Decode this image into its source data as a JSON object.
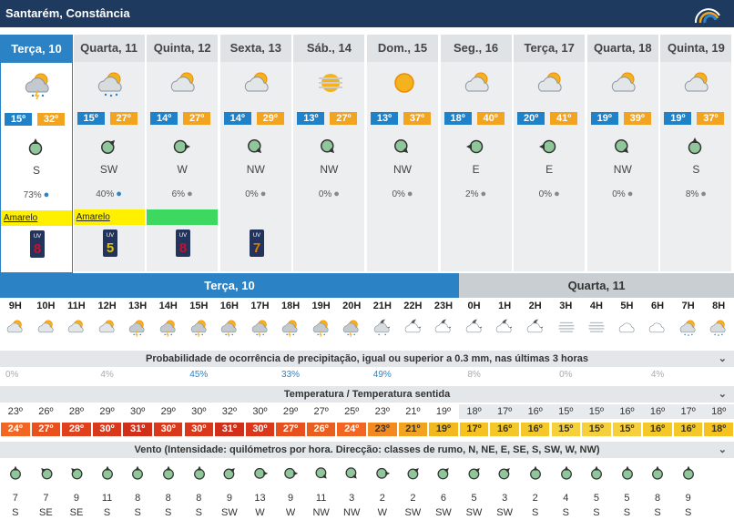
{
  "header": {
    "title": "Santarém, Constância",
    "logo": "ipma-logo-icon"
  },
  "days": [
    {
      "name": "Terça, 10",
      "icon": "storm-cloud-icon",
      "tmin": "15º",
      "tmax": "32º",
      "wind_dir": "S",
      "precip": "73%",
      "warning": "Amarelo",
      "warn_color": "#fff000",
      "uv": "8",
      "uv_color": "#c8102e",
      "selected": true,
      "rot": 0,
      "drop": "blue"
    },
    {
      "name": "Quarta, 11",
      "icon": "rain-cloud-icon",
      "tmin": "15º",
      "tmax": "27º",
      "wind_dir": "SW",
      "precip": "40%",
      "warning": "Amarelo",
      "warn_color": "#fff000",
      "uv": "5",
      "uv_color": "#e0c300",
      "selected": false,
      "rot": 45,
      "drop": "blue"
    },
    {
      "name": "Quinta, 12",
      "icon": "sun-cloud-icon",
      "tmin": "14º",
      "tmax": "27º",
      "wind_dir": "W",
      "precip": "6%",
      "warning": "",
      "warn_color": "#3cd860",
      "uv": "8",
      "uv_color": "#c8102e",
      "selected": false,
      "rot": 90,
      "drop": "grey"
    },
    {
      "name": "Sexta, 13",
      "icon": "sun-cloud-icon",
      "tmin": "14º",
      "tmax": "29º",
      "wind_dir": "NW",
      "precip": "0%",
      "warning": "",
      "warn_color": "",
      "uv": "7",
      "uv_color": "#e07a00",
      "selected": false,
      "rot": 135,
      "drop": "grey"
    },
    {
      "name": "Sáb., 14",
      "icon": "haze-sun-icon",
      "tmin": "13º",
      "tmax": "27º",
      "wind_dir": "NW",
      "precip": "0%",
      "warning": "",
      "warn_color": "",
      "uv": "",
      "uv_color": "",
      "selected": false,
      "rot": 135,
      "drop": "grey"
    },
    {
      "name": "Dom., 15",
      "icon": "sun-icon",
      "tmin": "13º",
      "tmax": "37º",
      "wind_dir": "NW",
      "precip": "0%",
      "warning": "",
      "warn_color": "",
      "uv": "",
      "uv_color": "",
      "selected": false,
      "rot": 135,
      "drop": "grey"
    },
    {
      "name": "Seg., 16",
      "icon": "sun-cloud-icon",
      "tmin": "18º",
      "tmax": "40º",
      "wind_dir": "E",
      "precip": "2%",
      "warning": "",
      "warn_color": "",
      "uv": "",
      "uv_color": "",
      "selected": false,
      "rot": 270,
      "drop": "grey"
    },
    {
      "name": "Terça, 17",
      "icon": "sun-cloud-icon",
      "tmin": "20º",
      "tmax": "41º",
      "wind_dir": "E",
      "precip": "0%",
      "warning": "",
      "warn_color": "",
      "uv": "",
      "uv_color": "",
      "selected": false,
      "rot": 270,
      "drop": "grey"
    },
    {
      "name": "Quarta, 18",
      "icon": "sun-cloud-icon",
      "tmin": "19º",
      "tmax": "39º",
      "wind_dir": "NW",
      "precip": "0%",
      "warning": "",
      "warn_color": "",
      "uv": "",
      "uv_color": "",
      "selected": false,
      "rot": 135,
      "drop": "grey"
    },
    {
      "name": "Quinta, 19",
      "icon": "sun-cloud-icon",
      "tmin": "19º",
      "tmax": "37º",
      "wind_dir": "S",
      "precip": "8%",
      "warning": "",
      "warn_color": "",
      "uv": "",
      "uv_color": "",
      "selected": false,
      "rot": 0,
      "drop": "grey"
    }
  ],
  "hourly": {
    "day_a": "Terça, 10",
    "day_b": "Quarta, 11",
    "hours": [
      "9H",
      "10H",
      "11H",
      "12H",
      "13H",
      "14H",
      "15H",
      "16H",
      "17H",
      "18H",
      "19H",
      "20H",
      "21H",
      "22H",
      "23H",
      "0H",
      "1H",
      "2H",
      "3H",
      "4H",
      "5H",
      "6H",
      "7H",
      "8H"
    ],
    "icons": [
      "sun-cloud-icon",
      "sun-cloud-icon",
      "sun-cloud-icon",
      "sun-cloud-icon",
      "storm-cloud-icon",
      "storm-cloud-icon",
      "storm-cloud-icon",
      "storm-cloud-icon",
      "storm-cloud-icon",
      "storm-cloud-icon",
      "storm-cloud-icon",
      "storm-cloud-icon",
      "moon-storm-icon",
      "moon-cloud-icon",
      "moon-cloud-icon",
      "moon-cloud-icon",
      "moon-cloud-icon",
      "moon-cloud-icon",
      "fog-icon",
      "fog-icon",
      "cloud-icon",
      "cloud-icon",
      "rain-cloud-icon",
      "rain-cloud-icon"
    ],
    "precip_title": "Probabilidade de ocorrência de precipitação, igual ou superior a 0.3 mm, nas últimas 3 horas",
    "precip": [
      {
        "v": "0%",
        "i": 0,
        "hi": false
      },
      {
        "v": "4%",
        "i": 3,
        "hi": false
      },
      {
        "v": "45%",
        "i": 6,
        "hi": true
      },
      {
        "v": "33%",
        "i": 9,
        "hi": true
      },
      {
        "v": "49%",
        "i": 12,
        "hi": true
      },
      {
        "v": "8%",
        "i": 15,
        "hi": false
      },
      {
        "v": "0%",
        "i": 18,
        "hi": false
      },
      {
        "v": "4%",
        "i": 21,
        "hi": false
      }
    ],
    "temp_title": "Temperatura / Temperatura sentida",
    "temp": [
      "23º",
      "26º",
      "28º",
      "29º",
      "30º",
      "29º",
      "30º",
      "32º",
      "30º",
      "29º",
      "27º",
      "25º",
      "23º",
      "21º",
      "19º",
      "18º",
      "17º",
      "16º",
      "15º",
      "15º",
      "16º",
      "16º",
      "17º",
      "18º"
    ],
    "feels": [
      "24º",
      "27º",
      "28º",
      "30º",
      "31º",
      "30º",
      "30º",
      "31º",
      "30º",
      "27º",
      "26º",
      "24º",
      "23º",
      "21º",
      "19º",
      "17º",
      "16º",
      "16º",
      "15º",
      "15º",
      "15º",
      "16º",
      "16º",
      "18º"
    ],
    "feels_colors": [
      "#f26522",
      "#e8501e",
      "#e0401c",
      "#d9381a",
      "#d22f1a",
      "#d9381a",
      "#d9381a",
      "#d22f1a",
      "#d9381a",
      "#e8501e",
      "#ea5f1f",
      "#f26522",
      "#f28a21",
      "#f2a31f",
      "#f2b91e",
      "#f5c21f",
      "#f5c829",
      "#f5c829",
      "#f6cf3c",
      "#f6cf3c",
      "#f6cf3c",
      "#f5c829",
      "#f5c829",
      "#f5c21f"
    ],
    "wind_title": "Vento (Intensidade: quilómetros por hora. Direcção: classes de rumo, N, NE, E, SE, S, SW, W, NW)",
    "wind_speed": [
      "7",
      "7",
      "9",
      "11",
      "8",
      "8",
      "8",
      "9",
      "13",
      "9",
      "11",
      "3",
      "2",
      "2",
      "6",
      "5",
      "3",
      "2",
      "4",
      "5",
      "5",
      "8",
      "9"
    ],
    "wind_dir": [
      "S",
      "SE",
      "SE",
      "S",
      "S",
      "S",
      "S",
      "SW",
      "W",
      "W",
      "NW",
      "NW",
      "W",
      "SW",
      "SW",
      "SW",
      "SW",
      "S",
      "S",
      "S",
      "S",
      "S",
      "S"
    ]
  }
}
